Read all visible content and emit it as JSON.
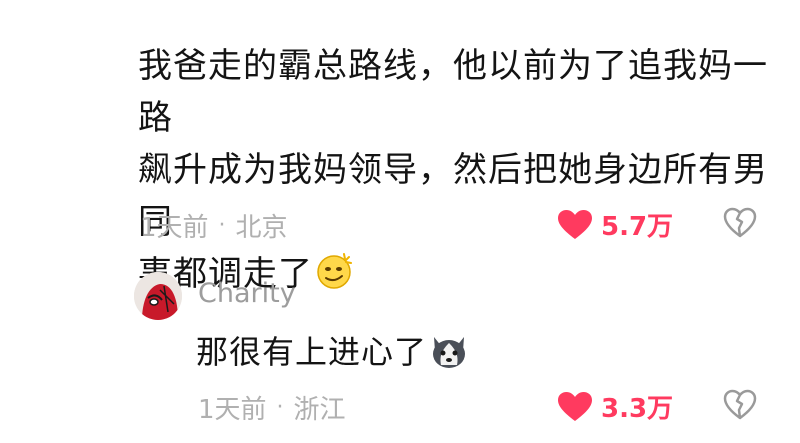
{
  "comment": {
    "lines": [
      "我爸走的霸总路线，他以前为了追我妈一路",
      "飙升成为我妈领导，然后把她身边所有男同",
      "事都调走了"
    ],
    "emoji": "smirk-sun-emoji",
    "time": "1天前",
    "separator": "·",
    "location": "北京",
    "likes": "5.7万"
  },
  "reply": {
    "username": "Charity",
    "text": "那很有上进心了",
    "emoji": "husky-dog-emoji",
    "time": "1天前",
    "separator": "·",
    "location": "浙江",
    "likes": "3.3万"
  },
  "colors": {
    "like": "#ff3a5f",
    "meta": "#b0b0b0",
    "username": "#9d9d9d"
  },
  "icons": {
    "like": "heart-icon",
    "dislike": "broken-heart-icon"
  }
}
